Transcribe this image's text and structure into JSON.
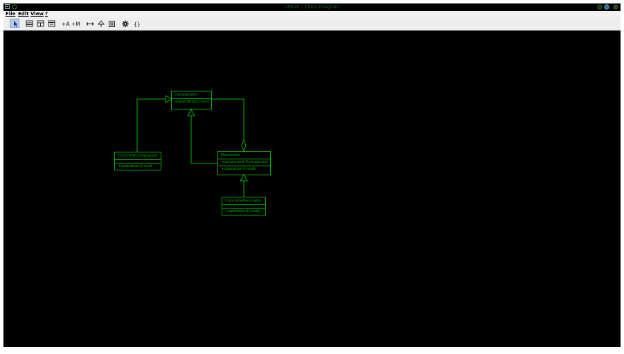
{
  "window": {
    "title": "UMLet - Class Diagram",
    "accent_color": "#00b400"
  },
  "menu": {
    "items": [
      {
        "label": "File",
        "name": "menu-file"
      },
      {
        "label": "Edit",
        "name": "menu-edit"
      },
      {
        "label": "View",
        "name": "menu-view"
      },
      {
        "label": "?",
        "name": "menu-help"
      }
    ]
  },
  "toolbar": {
    "tools": [
      {
        "name": "select-tool-button",
        "icon": "pointer-icon",
        "selected": true
      },
      {
        "name": "add-class-tool-button",
        "icon": "class-icon"
      },
      {
        "name": "add-interface-tool-button",
        "icon": "interface-icon"
      },
      {
        "name": "add-abstract-class-tool-button",
        "icon": "abstract-class-icon"
      },
      {
        "name": "add-attribute-button",
        "icon": "add-attribute-icon",
        "label": "+A"
      },
      {
        "name": "add-method-button",
        "icon": "add-method-icon",
        "label": "+M"
      },
      {
        "name": "association-tool-button",
        "icon": "association-arrow-icon"
      },
      {
        "name": "generalization-tool-button",
        "icon": "generalization-arrow-icon"
      },
      {
        "name": "note-tool-button",
        "icon": "note-icon"
      },
      {
        "name": "settings-tool-button",
        "icon": "gear-icon"
      },
      {
        "name": "code-tool-button",
        "icon": "braces-icon",
        "label": "{}"
      }
    ]
  },
  "diagram": {
    "classes": {
      "component": {
        "name": "Component",
        "methods": [
          "+operation():void"
        ]
      },
      "concrete_component": {
        "name": "ConcreteComponent",
        "methods": [
          "+operation():void"
        ]
      },
      "decorator": {
        "name": "Decorator",
        "attributes": [
          "-component:Component"
        ],
        "methods": [
          "+operation():void"
        ]
      },
      "concrete_decorator": {
        "name": "ConcreteDecorator",
        "methods": [
          "+operation():void"
        ]
      }
    },
    "relationships": [
      {
        "from": "ConcreteComponent",
        "to": "Component",
        "type": "generalization"
      },
      {
        "from": "Decorator",
        "to": "Component",
        "type": "generalization"
      },
      {
        "from": "Decorator",
        "to": "Component",
        "type": "aggregation"
      },
      {
        "from": "ConcreteDecorator",
        "to": "Decorator",
        "type": "generalization"
      }
    ]
  }
}
